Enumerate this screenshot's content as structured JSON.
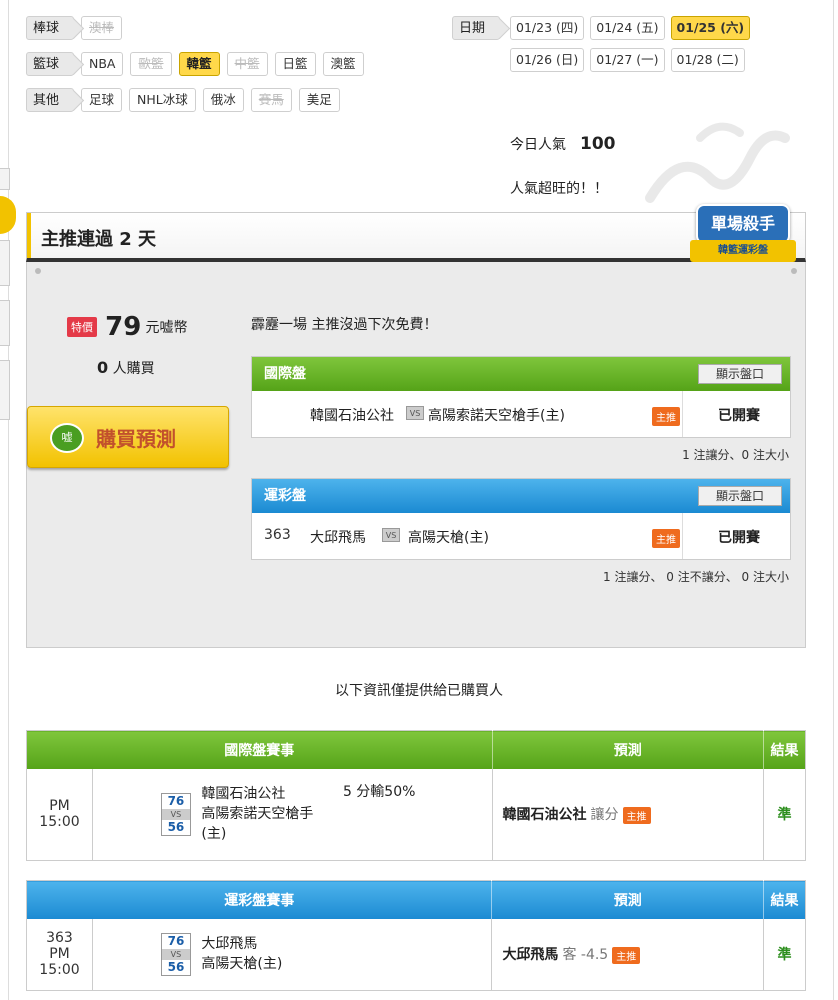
{
  "filters": {
    "categories": [
      {
        "label": "棒球",
        "items": [
          {
            "label": "澳棒",
            "state": "disabled"
          }
        ]
      },
      {
        "label": "籃球",
        "items": [
          {
            "label": "NBA",
            "state": "normal"
          },
          {
            "label": "歐籃",
            "state": "disabled"
          },
          {
            "label": "韓籃",
            "state": "active"
          },
          {
            "label": "中籃",
            "state": "disabled"
          },
          {
            "label": "日籃",
            "state": "normal"
          },
          {
            "label": "澳籃",
            "state": "normal"
          }
        ]
      },
      {
        "label": "其他",
        "items": [
          {
            "label": "足球",
            "state": "normal"
          },
          {
            "label": "NHL冰球",
            "state": "normal"
          },
          {
            "label": "俄冰",
            "state": "normal"
          },
          {
            "label": "賽馬",
            "state": "disabled"
          },
          {
            "label": "美足",
            "state": "normal"
          }
        ]
      }
    ],
    "date_label": "日期",
    "dates": [
      {
        "label": "01/23 (四)",
        "state": "normal"
      },
      {
        "label": "01/24 (五)",
        "state": "normal"
      },
      {
        "label": "01/25 (六)",
        "state": "active"
      },
      {
        "label": "01/26 (日)",
        "state": "normal"
      },
      {
        "label": "01/27 (一)",
        "state": "normal"
      },
      {
        "label": "01/28 (二)",
        "state": "normal"
      }
    ]
  },
  "popularity": {
    "label": "今日人氣",
    "value": "100",
    "status": "人氣超旺的！！"
  },
  "section": {
    "title": "主推連過 2 天",
    "badge_title": "單場殺手",
    "badge_sub": "韓籃運彩盤"
  },
  "purchase": {
    "sale_tag": "特價",
    "price": "79",
    "unit": "元嘘幣",
    "buyers_count": "0",
    "buyers_suffix": "人購買",
    "buy_icon": "嘘",
    "buy_label": "購買預測",
    "promo": "霹靂一場 主推沒過下次免費！"
  },
  "markets": [
    {
      "title": "國際盤",
      "show_label": "顯示盤口",
      "code": "",
      "team_a": "韓國石油公社",
      "vs": "VS",
      "team_b": "高陽索諾天空槍手(主)",
      "host_tag": "主推",
      "status": "已開賽",
      "note": "1 注讓分、0 注大小"
    },
    {
      "title": "運彩盤",
      "show_label": "顯示盤口",
      "code": "363",
      "team_a": "大邱飛馬",
      "vs": "VS",
      "team_b": "高陽天槍(主)",
      "host_tag": "主推",
      "status": "已開賽",
      "note": "1 注讓分、 0 注不讓分、 0 注大小"
    }
  ],
  "info_line": "以下資訊僅提供給已購買人",
  "results": [
    {
      "head": {
        "match": "國際盤賽事",
        "pred": "預測",
        "result": "結果"
      },
      "code": "",
      "time": "PM 15:00",
      "score_a": "76",
      "score_vs": "VS",
      "score_b": "56",
      "team_a": "韓國石油公社",
      "team_b": "高陽索諾天空槍手(主)",
      "odds": "5 分輸50%",
      "pred_team": "韓國石油公社",
      "pred_sub": "讓分",
      "pred_host": "主推",
      "result": "準"
    },
    {
      "head": {
        "match": "運彩盤賽事",
        "pred": "預測",
        "result": "結果"
      },
      "code": "363",
      "time": "PM 15:00",
      "score_a": "76",
      "score_vs": "VS",
      "score_b": "56",
      "team_a": "大邱飛馬",
      "team_b": "高陽天槍(主)",
      "odds": "",
      "pred_team": "大邱飛馬",
      "pred_sub": "客 -4.5",
      "pred_host": "主推",
      "result": "準"
    }
  ],
  "colors": {
    "active_chip": "#ffd84a",
    "green_header": "#55a318",
    "blue_header": "#1b8ad2",
    "host_tag": "#ef6b1e",
    "result_ok": "#2d8f1e"
  }
}
